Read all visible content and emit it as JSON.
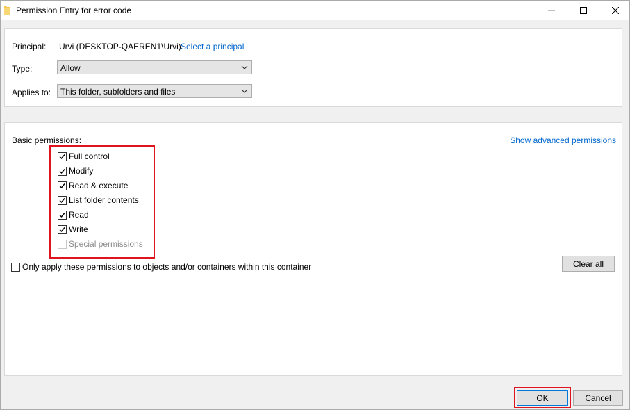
{
  "window": {
    "title": "Permission Entry for error code",
    "icons": {
      "app": "folder-icon",
      "minimize": "minimize-icon",
      "maximize": "maximize-icon",
      "close": "close-icon"
    }
  },
  "principal": {
    "label": "Principal:",
    "value": "Urvi (DESKTOP-QAEREN1\\Urvi)",
    "link": "Select a principal"
  },
  "type": {
    "label": "Type:",
    "value": "Allow"
  },
  "applies_to": {
    "label": "Applies to:",
    "value": "This folder, subfolders and files"
  },
  "basic_permissions": {
    "label": "Basic permissions:",
    "advanced_link": "Show advanced permissions",
    "items": [
      {
        "label": "Full control",
        "checked": true,
        "enabled": true
      },
      {
        "label": "Modify",
        "checked": true,
        "enabled": true
      },
      {
        "label": "Read & execute",
        "checked": true,
        "enabled": true
      },
      {
        "label": "List folder contents",
        "checked": true,
        "enabled": true
      },
      {
        "label": "Read",
        "checked": true,
        "enabled": true
      },
      {
        "label": "Write",
        "checked": true,
        "enabled": true
      },
      {
        "label": "Special permissions",
        "checked": false,
        "enabled": false
      }
    ]
  },
  "only_apply": {
    "label": "Only apply these permissions to objects and/or containers within this container",
    "checked": false
  },
  "buttons": {
    "clear_all": "Clear all",
    "ok": "OK",
    "cancel": "Cancel"
  },
  "colors": {
    "accent": "#0066cc",
    "highlight": "#e0141e"
  }
}
